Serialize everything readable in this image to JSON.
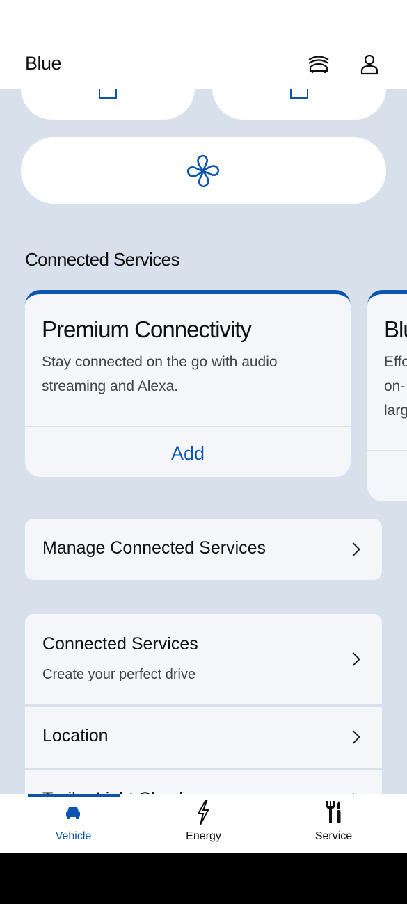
{
  "header": {
    "title": "Blue",
    "icons": [
      "connected-car-icon",
      "account-icon"
    ]
  },
  "controls": {
    "fan_icon": "fan-icon",
    "accent": "#0b55b0"
  },
  "connected_services": {
    "title": "Connected Services",
    "cards": [
      {
        "title": "Premium Connectivity",
        "description": "Stay connected on the go with audio\nstreaming and Alexa.",
        "action": "Add"
      },
      {
        "title": "Blu",
        "description": "Effo\non-\nlarg"
      }
    ],
    "manage": "Manage Connected Services",
    "list": [
      {
        "label": "Connected Services",
        "sub": "Create your perfect drive"
      },
      {
        "label": "Location"
      },
      {
        "label": "Trailer Light Check"
      }
    ]
  },
  "nav": {
    "tabs": [
      {
        "label": "Vehicle",
        "active": true
      },
      {
        "label": "Energy"
      },
      {
        "label": "Service"
      }
    ]
  },
  "colors": {
    "background": "#d7e0eb",
    "card": "#f4f6f9",
    "accent": "#0b55b0"
  }
}
